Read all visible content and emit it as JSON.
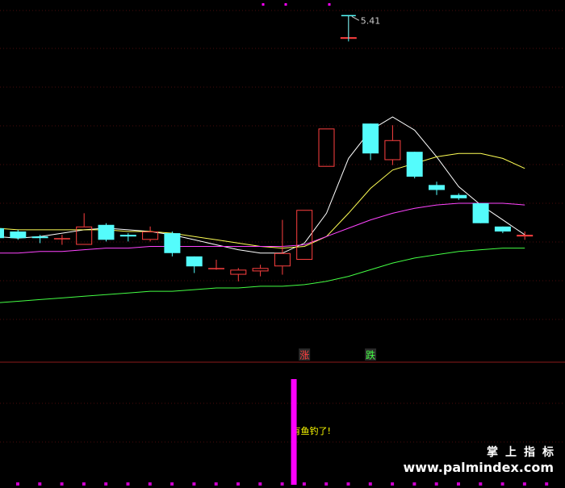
{
  "chart_data": {
    "type": "candlestick",
    "price_range": [
      3.43,
      5.47
    ],
    "high_label": "5.41",
    "up_color": "#ff4040",
    "down_color": "#54fcfc",
    "candles": [
      {
        "o": 4.13,
        "h": 4.13,
        "l": 4.05,
        "c": 4.07
      },
      {
        "o": 4.11,
        "h": 4.12,
        "l": 4.06,
        "c": 4.07
      },
      {
        "o": 4.08,
        "h": 4.09,
        "l": 4.04,
        "c": 4.07
      },
      {
        "o": 4.07,
        "h": 4.09,
        "l": 4.03,
        "c": 4.07
      },
      {
        "o": 4.03,
        "h": 4.22,
        "l": 4.03,
        "c": 4.14
      },
      {
        "o": 4.15,
        "h": 4.16,
        "l": 4.05,
        "c": 4.06
      },
      {
        "o": 4.09,
        "h": 4.1,
        "l": 4.05,
        "c": 4.08
      },
      {
        "o": 4.06,
        "h": 4.14,
        "l": 4.05,
        "c": 4.11
      },
      {
        "o": 4.1,
        "h": 4.11,
        "l": 3.96,
        "c": 3.98
      },
      {
        "o": 3.96,
        "h": 3.96,
        "l": 3.86,
        "c": 3.9
      },
      {
        "o": 3.89,
        "h": 3.94,
        "l": 3.88,
        "c": 3.89
      },
      {
        "o": 3.85,
        "h": 3.89,
        "l": 3.81,
        "c": 3.88
      },
      {
        "o": 3.87,
        "h": 3.91,
        "l": 3.84,
        "c": 3.89
      },
      {
        "o": 3.9,
        "h": 4.18,
        "l": 3.85,
        "c": 3.98
      },
      {
        "o": 3.94,
        "h": 4.24,
        "l": 3.94,
        "c": 4.24
      },
      {
        "o": 4.5,
        "h": 4.73,
        "l": 4.5,
        "c": 4.73
      },
      {
        "o": 5.27,
        "h": 5.41,
        "l": 5.27,
        "c": 5.28
      },
      {
        "o": 4.76,
        "h": 4.76,
        "l": 4.54,
        "c": 4.58
      },
      {
        "o": 4.54,
        "h": 4.75,
        "l": 4.51,
        "c": 4.66
      },
      {
        "o": 4.59,
        "h": 4.59,
        "l": 4.43,
        "c": 4.44
      },
      {
        "o": 4.39,
        "h": 4.41,
        "l": 4.33,
        "c": 4.36
      },
      {
        "o": 4.33,
        "h": 4.34,
        "l": 4.3,
        "c": 4.31
      },
      {
        "o": 4.28,
        "h": 4.28,
        "l": 4.16,
        "c": 4.16
      },
      {
        "o": 4.14,
        "h": 4.14,
        "l": 4.1,
        "c": 4.11
      },
      {
        "o": 4.08,
        "h": 4.11,
        "l": 4.06,
        "c": 4.09
      }
    ],
    "series": [
      {
        "color": "#ffffff",
        "values": [
          4.08,
          4.07,
          4.08,
          4.1,
          4.12,
          4.13,
          4.12,
          4.11,
          4.09,
          4.06,
          4.03,
          4.0,
          3.98,
          3.98,
          4.04,
          4.22,
          4.55,
          4.72,
          4.8,
          4.72,
          4.56,
          4.38,
          4.27,
          4.18,
          4.09
        ]
      },
      {
        "color": "#ffff55",
        "values": [
          4.13,
          4.12,
          4.12,
          4.12,
          4.12,
          4.12,
          4.11,
          4.11,
          4.1,
          4.08,
          4.06,
          4.04,
          4.02,
          4.01,
          4.02,
          4.08,
          4.22,
          4.37,
          4.48,
          4.52,
          4.56,
          4.58,
          4.58,
          4.55,
          4.49
        ]
      },
      {
        "color": "#ff44ff",
        "values": [
          3.98,
          3.98,
          3.99,
          3.99,
          4.0,
          4.01,
          4.01,
          4.02,
          4.02,
          4.02,
          4.02,
          4.02,
          4.02,
          4.02,
          4.03,
          4.08,
          4.13,
          4.18,
          4.22,
          4.25,
          4.27,
          4.28,
          4.28,
          4.28,
          4.27
        ]
      },
      {
        "color": "#44ff44",
        "values": [
          3.68,
          3.69,
          3.7,
          3.71,
          3.72,
          3.73,
          3.74,
          3.75,
          3.75,
          3.76,
          3.77,
          3.77,
          3.78,
          3.78,
          3.79,
          3.81,
          3.84,
          3.88,
          3.92,
          3.95,
          3.97,
          3.99,
          4.0,
          4.01,
          4.01
        ]
      }
    ],
    "signals": [
      {
        "index": 14,
        "text": "涨",
        "color": "#ff4040"
      },
      {
        "index": 17,
        "text": "跌",
        "color": "#44ff44"
      }
    ],
    "indicator": {
      "bar_index": 13,
      "bar_value": 1,
      "label": "有鱼钓了!",
      "label_color": "#ffff00",
      "bar_color": "#ff00ff"
    }
  },
  "watermark": {
    "title": "掌上指标",
    "url": "www.palmindex.com"
  }
}
